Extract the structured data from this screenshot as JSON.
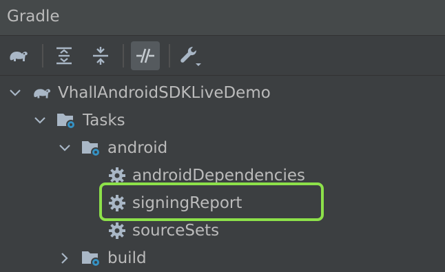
{
  "panel": {
    "title": "Gradle"
  },
  "toolbar": {
    "buttons": [
      {
        "name": "gradle-elephant-icon"
      },
      {
        "name": "expand-all-icon"
      },
      {
        "name": "collapse-all-icon"
      },
      {
        "name": "toggle-offline-icon"
      },
      {
        "name": "build-tool-settings-icon"
      }
    ]
  },
  "tree": {
    "project": "VhallAndroidSDKLiveDemo",
    "tasks_folder": "Tasks",
    "android_folder": "android",
    "tasks": [
      "androidDependencies",
      "signingReport",
      "sourceSets"
    ],
    "build_folder": "build"
  },
  "colors": {
    "background": "#3c3f41",
    "text": "#bbbbbb",
    "icon_gray": "#a9b7c6",
    "gear_blue": "#3592c4",
    "highlight_green": "#8de14a"
  }
}
